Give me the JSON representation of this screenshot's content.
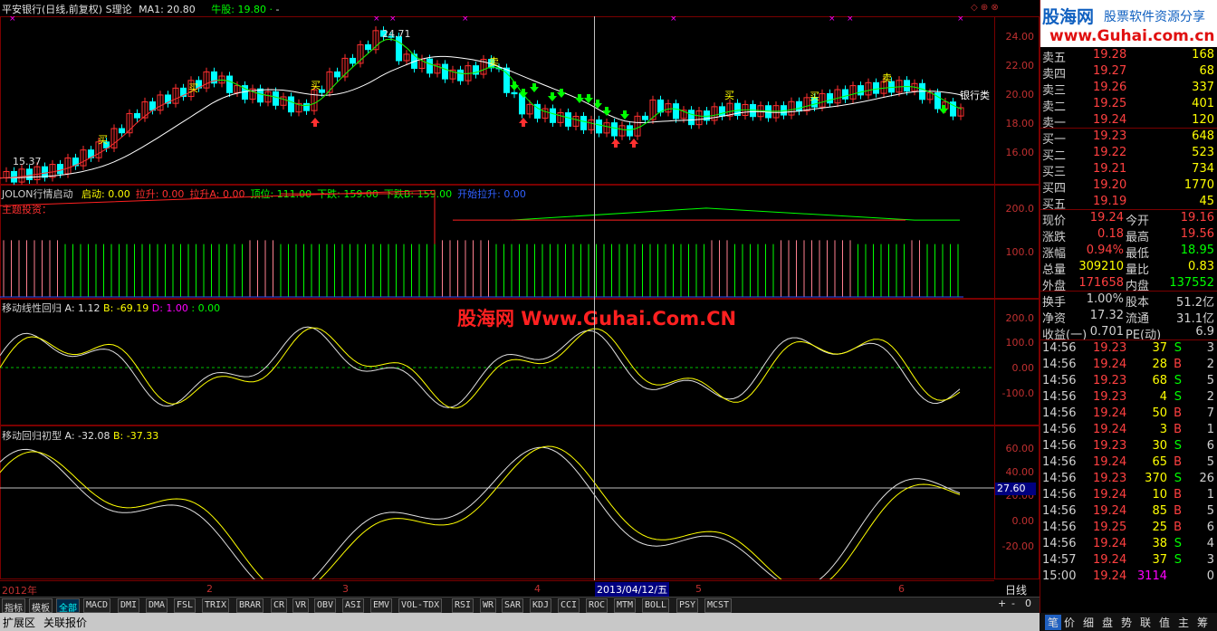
{
  "header": {
    "stock": "平安银行(日线,前复权)",
    "indicator": "S理论",
    "ma1": "MA1: 20.80",
    "nugu": "牛股: 19.80",
    "nugu_suffix": "·",
    "extra": "-",
    "high_mark": "24.71",
    "low_mark": "15.37",
    "buy_label": "买",
    "sell_label": "卖",
    "bank_label": "银行类"
  },
  "main_axis": [
    "24.00",
    "22.00",
    "20.00",
    "18.00",
    "16.00"
  ],
  "panel2": {
    "title": "JOLON行情启动",
    "items": [
      {
        "label": "启动: 0.00",
        "color": "#ffff00"
      },
      {
        "label": "拉升: 0.00",
        "color": "#ff3030"
      },
      {
        "label": "拉升A: 0.00",
        "color": "#ff3030"
      },
      {
        "label": "顶位: 111.00",
        "color": "#00ff00"
      },
      {
        "label": "下跌: 159.00",
        "color": "#00ff00"
      },
      {
        "label": "下跌B: 159.00",
        "color": "#00ff00"
      },
      {
        "label": "开始拉升: 0.00",
        "color": "#3060ff"
      }
    ],
    "subtitle": "主题投资：",
    "axis": [
      "200.0",
      "100.0"
    ]
  },
  "panel3": {
    "title": "移动线性回归",
    "a": "A: 1.12",
    "b": "B: -69.19",
    "d": "D: 1.00",
    "e": ": 0.00",
    "axis": [
      "200.0",
      "100.0",
      "0.00",
      "-100.0"
    ]
  },
  "watermark": "股海网 Www.Guhai.Com.CN",
  "panel4": {
    "title": "移动回归初型",
    "a": "A: -32.08",
    "b": "B: -37.33",
    "axis": [
      "60.00",
      "40.00",
      "20.00",
      "0.00",
      "-20.00"
    ],
    "cursor_value": "27.60"
  },
  "xaxis": {
    "labels": [
      "2012年",
      "2",
      "3",
      "4",
      "5",
      "6"
    ],
    "cursor_date": "2013/04/12/五",
    "period": "日线"
  },
  "quotes": {
    "logo_title": "股海网",
    "logo_sub": "股票软件资源分享",
    "logo_url": "www.Guhai.com.cn",
    "asks": [
      {
        "label": "卖五",
        "price": "19.28",
        "vol": "168"
      },
      {
        "label": "卖四",
        "price": "19.27",
        "vol": "68"
      },
      {
        "label": "卖三",
        "price": "19.26",
        "vol": "337"
      },
      {
        "label": "卖二",
        "price": "19.25",
        "vol": "401"
      },
      {
        "label": "卖一",
        "price": "19.24",
        "vol": "120"
      }
    ],
    "bids": [
      {
        "label": "买一",
        "price": "19.23",
        "vol": "648"
      },
      {
        "label": "买二",
        "price": "19.22",
        "vol": "523"
      },
      {
        "label": "买三",
        "price": "19.21",
        "vol": "734"
      },
      {
        "label": "买四",
        "price": "19.20",
        "vol": "1770"
      },
      {
        "label": "买五",
        "price": "19.19",
        "vol": "45"
      }
    ],
    "stats": [
      {
        "l1": "现价",
        "v1": "19.24",
        "c1": "#ff4040",
        "l2": "今开",
        "v2": "19.16",
        "c2": "#ff4040"
      },
      {
        "l1": "涨跌",
        "v1": "0.18",
        "c1": "#ff4040",
        "l2": "最高",
        "v2": "19.56",
        "c2": "#ff4040"
      },
      {
        "l1": "涨幅",
        "v1": "0.94%",
        "c1": "#ff4040",
        "l2": "最低",
        "v2": "18.95",
        "c2": "#00ff00"
      },
      {
        "l1": "总量",
        "v1": "309210",
        "c1": "#ffff00",
        "l2": "量比",
        "v2": "0.83",
        "c2": "#ffff00"
      },
      {
        "l1": "外盘",
        "v1": "171658",
        "c1": "#ff4040",
        "l2": "内盘",
        "v2": "137552",
        "c2": "#00ff00"
      }
    ],
    "fin": [
      {
        "l1": "换手",
        "v1": "1.00%",
        "l2": "股本",
        "v2": "51.2亿"
      },
      {
        "l1": "净资",
        "v1": "17.32",
        "l2": "流通",
        "v2": "31.1亿"
      },
      {
        "l1": "收益(一)",
        "v1": "0.701",
        "l2": "PE(动)",
        "v2": "6.9"
      }
    ],
    "ticks": [
      {
        "t": "14:56",
        "p": "19.23",
        "v": "37",
        "s": "S",
        "n": "3"
      },
      {
        "t": "14:56",
        "p": "19.24",
        "v": "28",
        "s": "B",
        "n": "2"
      },
      {
        "t": "14:56",
        "p": "19.23",
        "v": "68",
        "s": "S",
        "n": "5"
      },
      {
        "t": "14:56",
        "p": "19.23",
        "v": "4",
        "s": "S",
        "n": "2"
      },
      {
        "t": "14:56",
        "p": "19.24",
        "v": "50",
        "s": "B",
        "n": "7"
      },
      {
        "t": "14:56",
        "p": "19.24",
        "v": "3",
        "s": "B",
        "n": "1"
      },
      {
        "t": "14:56",
        "p": "19.23",
        "v": "30",
        "s": "S",
        "n": "6"
      },
      {
        "t": "14:56",
        "p": "19.24",
        "v": "65",
        "s": "B",
        "n": "5"
      },
      {
        "t": "14:56",
        "p": "19.23",
        "v": "370",
        "s": "S",
        "n": "26"
      },
      {
        "t": "14:56",
        "p": "19.24",
        "v": "10",
        "s": "B",
        "n": "1"
      },
      {
        "t": "14:56",
        "p": "19.24",
        "v": "85",
        "s": "B",
        "n": "5"
      },
      {
        "t": "14:56",
        "p": "19.25",
        "v": "25",
        "s": "B",
        "n": "6"
      },
      {
        "t": "14:56",
        "p": "19.24",
        "v": "38",
        "s": "S",
        "n": "4"
      },
      {
        "t": "14:57",
        "p": "19.24",
        "v": "37",
        "s": "S",
        "n": "3"
      },
      {
        "t": "15:00",
        "p": "19.24",
        "v": "3114",
        "s": "",
        "n": "0"
      }
    ]
  },
  "tabs": [
    "指标",
    "模板",
    "全部",
    "MACD",
    "DMI",
    "DMA",
    "FSL",
    "TRIX",
    "BRAR",
    "CR",
    "VR",
    "OBV",
    "ASI",
    "EMV",
    "VOL-TDX",
    "RSI",
    "WR",
    "SAR",
    "KDJ",
    "CCI",
    "ROC",
    "MTM",
    "BOLL",
    "PSY",
    "MCST"
  ],
  "tab_right": [
    "+",
    "-",
    "0"
  ],
  "bottom": [
    "扩展区",
    "关联报价"
  ],
  "right_tabs": [
    "笔",
    "价",
    "细",
    "盘",
    "势",
    "联",
    "值",
    "主",
    "筹"
  ],
  "colors": {
    "up": "#ff3030",
    "down": "#00ffff",
    "border": "#7a0000"
  }
}
